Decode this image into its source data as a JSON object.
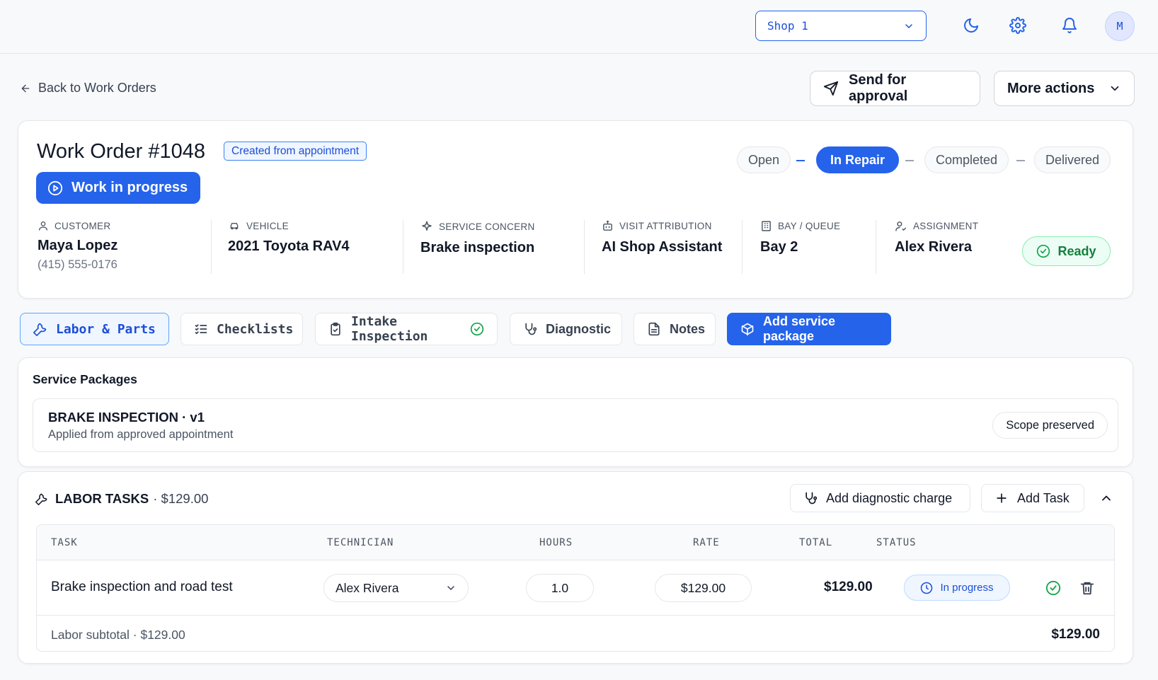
{
  "topbar": {
    "shop": "Shop 1",
    "avatar_initial": "M"
  },
  "back_link": "Back to Work Orders",
  "actions": {
    "send": "Send for approval",
    "more": "More actions"
  },
  "work_order": {
    "title": "Work Order #1048",
    "badge": "Created from appointment",
    "state_button": "Work in progress",
    "stages": [
      "Open",
      "In Repair",
      "Completed",
      "Delivered"
    ],
    "active_stage": "In Repair",
    "info": {
      "customer": {
        "label": "CUSTOMER",
        "value": "Maya Lopez",
        "sub": "(415) 555-0176"
      },
      "vehicle": {
        "label": "VEHICLE",
        "value": "2021 Toyota RAV4"
      },
      "concern": {
        "label": "SERVICE CONCERN",
        "value": "Brake inspection"
      },
      "attribution": {
        "label": "VISIT ATTRIBUTION",
        "value": "AI Shop Assistant"
      },
      "bay": {
        "label": "BAY / QUEUE",
        "value": "Bay 2"
      },
      "assignment": {
        "label": "ASSIGNMENT",
        "value": "Alex Rivera"
      }
    },
    "ready": "Ready"
  },
  "tabs": {
    "labor_parts": "Labor & Parts",
    "checklists": "Checklists",
    "intake": "Intake Inspection",
    "diagnostic": "Diagnostic",
    "notes": "Notes",
    "add_package": "Add service package"
  },
  "service_packages": {
    "title": "Service Packages",
    "package_name": "BRAKE INSPECTION · v1",
    "package_sub": "Applied from approved appointment",
    "scope": "Scope preserved"
  },
  "labor": {
    "title": "LABOR TASKS",
    "title_amount": "· $129.00",
    "add_diag": "Add diagnostic charge",
    "add_task": "Add Task",
    "columns": [
      "TASK",
      "TECHNICIAN",
      "HOURS",
      "RATE",
      "TOTAL",
      "STATUS"
    ],
    "row": {
      "task": "Brake inspection and road test",
      "technician": "Alex Rivera",
      "hours": "1.0",
      "rate": "$129.00",
      "total": "$129.00",
      "status": "In progress"
    },
    "subtotal_label": "Labor subtotal · $129.00",
    "subtotal_value": "$129.00"
  },
  "colors": {
    "accent": "#2563eb",
    "success": "#16a34a"
  }
}
